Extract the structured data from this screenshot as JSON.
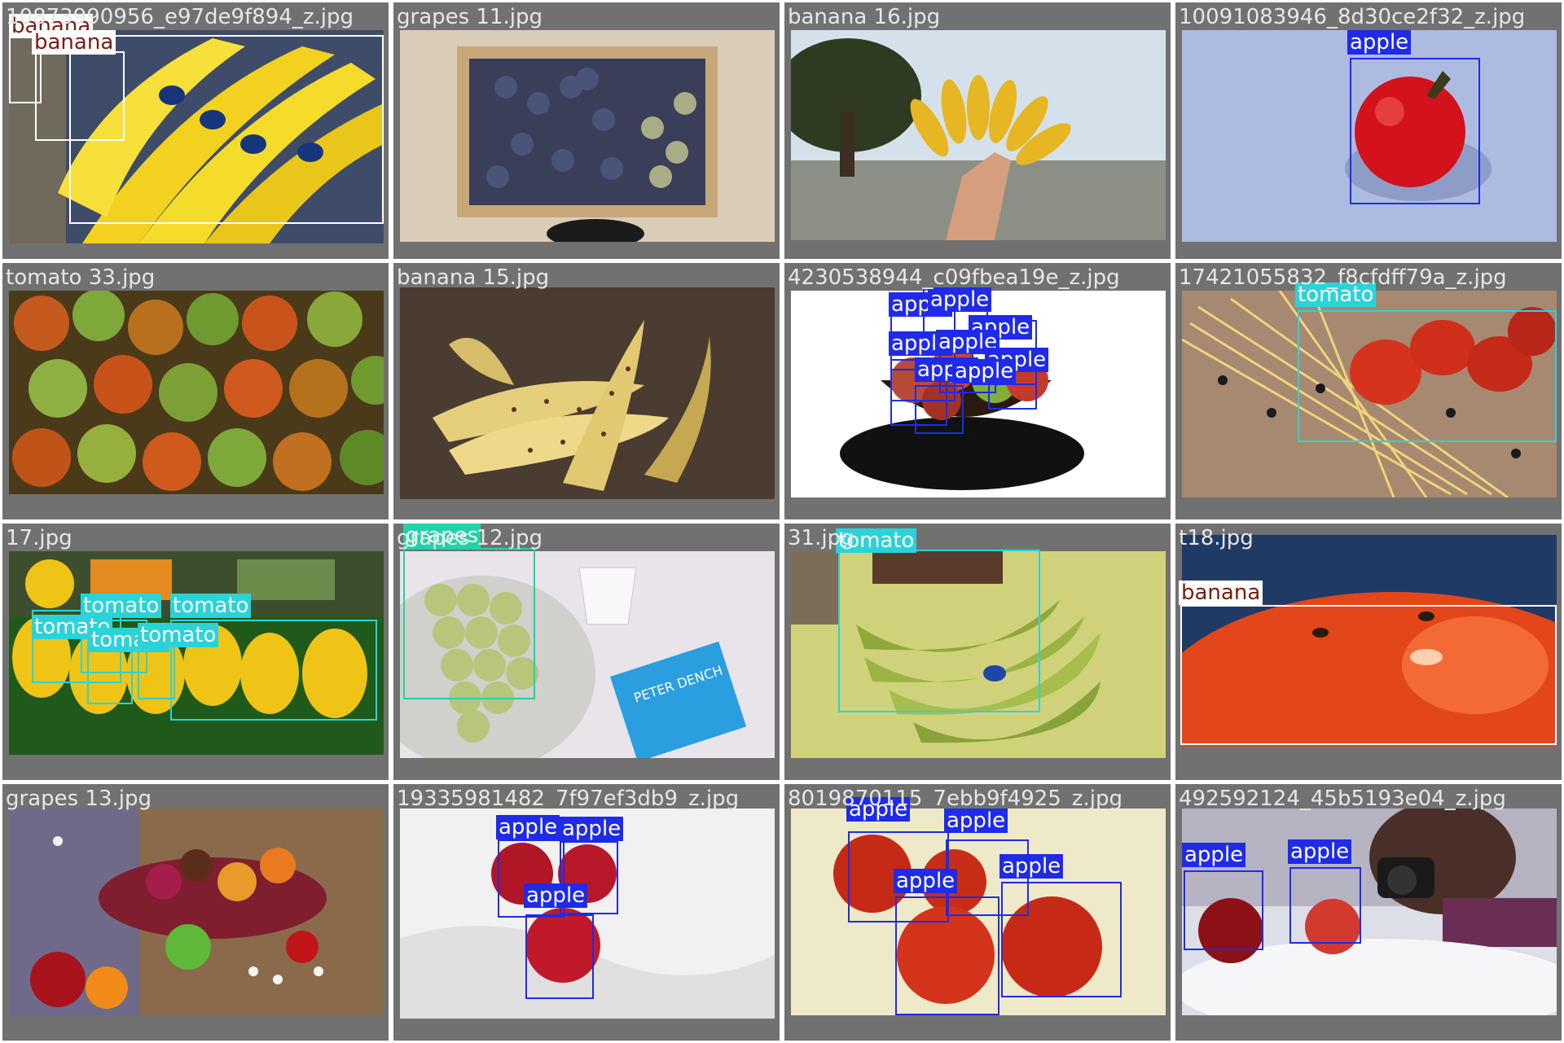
{
  "colors": {
    "apple": "#1f2be8",
    "tomato": "#2bd3d9",
    "grapes": "#1fd2aa",
    "banana": "#ffffff",
    "cell_background": "#717171"
  },
  "tiles": [
    {
      "filename": "10873990956_e97de9f894_z.jpg",
      "labels": [
        "banana",
        "banana",
        "banana"
      ]
    },
    {
      "filename": "grapes 11.jpg",
      "labels": []
    },
    {
      "filename": "banana 16.jpg",
      "labels": []
    },
    {
      "filename": "10091083946_8d30ce2f32_z.jpg",
      "labels": [
        "apple"
      ]
    },
    {
      "filename": "tomato 33.jpg",
      "labels": []
    },
    {
      "filename": "banana 15.jpg",
      "labels": []
    },
    {
      "filename": "4230538944_c09fbea19e_z.jpg",
      "labels": [
        "apple",
        "apple",
        "apple",
        "apple",
        "apple",
        "apple",
        "apple",
        "apple"
      ]
    },
    {
      "filename": "17421055832_f8cfdff79a_z.jpg",
      "labels": [
        "tomato"
      ]
    },
    {
      "filename": "17.jpg",
      "labels": [
        "tomato",
        "tomato",
        "tomato",
        "tomato",
        "tomato"
      ]
    },
    {
      "filename": "grapes 12.jpg",
      "labels": [
        "grapes"
      ]
    },
    {
      "filename": "31.jpg",
      "labels": [
        "tomato"
      ]
    },
    {
      "filename": "t18.jpg",
      "labels": [
        "banana"
      ]
    },
    {
      "filename": "grapes 13.jpg",
      "labels": []
    },
    {
      "filename": "19335981482_7f97ef3db9_z.jpg",
      "labels": [
        "apple",
        "apple",
        "apple"
      ]
    },
    {
      "filename": "8019870115_7ebb9f4925_z.jpg",
      "labels": [
        "apple",
        "apple",
        "apple",
        "apple"
      ]
    },
    {
      "filename": "492592124_45b5193e04_z.jpg",
      "labels": [
        "apple",
        "apple"
      ]
    }
  ]
}
